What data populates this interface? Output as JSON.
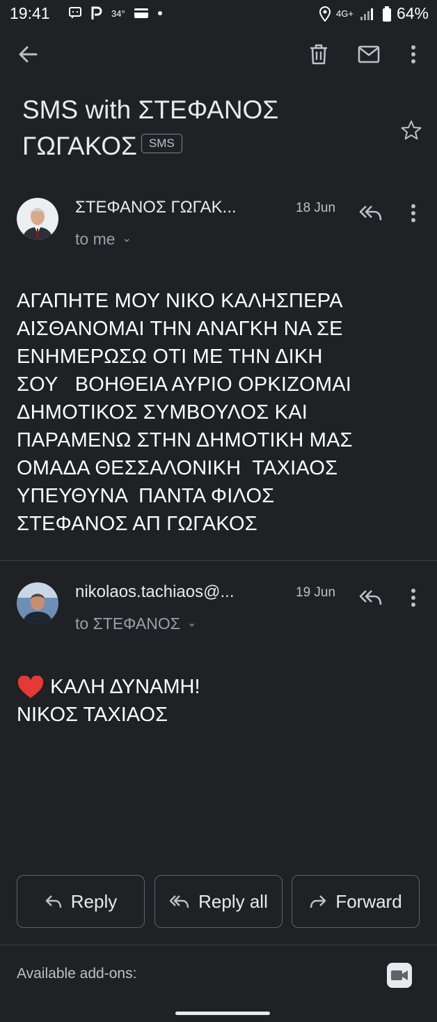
{
  "status_bar": {
    "time": "19:41",
    "temperature": "34°",
    "network": "4G+",
    "battery": "64%",
    "icons": [
      "message-icon",
      "parking-icon",
      "card-icon",
      "dot-icon",
      "location-icon",
      "signal-icon",
      "battery-icon"
    ]
  },
  "toolbar": {
    "icons": [
      "back-arrow-icon",
      "trash-icon",
      "mail-icon",
      "more-vert-icon"
    ]
  },
  "subject": {
    "title": "SMS with ΣΤΕΦΑΝΟΣ ΓΩΓΑΚΟΣ",
    "badge": "SMS"
  },
  "messages": [
    {
      "sender": "ΣΤΕΦΑΝΟΣ ΓΩΓΑΚ...",
      "date": "18 Jun",
      "to": "to me",
      "body": "ΑΓΑΠΗΤΕ ΜΟΥ ΝΙΚΟ ΚΑΛΗΣΠΕΡΑ\nΑΙΣΘΑΝΟΜΑΙ ΤΗΝ ΑΝΑΓΚΗ ΝΑ ΣΕ\nΕΝΗΜΕΡΩΣΩ ΟΤΙ ΜΕ ΤΗΝ ΔΙΚΗ\nΣΟΥ   ΒΟΗΘΕΙΑ ΑΥΡΙΟ ΟΡΚΙΖΟΜΑΙ\nΔΗΜΟΤΙΚΟΣ ΣΥΜΒΟΥΛΟΣ ΚΑΙ\nΠΑΡΑΜΕΝΩ ΣΤΗΝ ΔΗΜΟΤΙΚΗ ΜΑΣ\nΟΜΑΔΑ ΘΕΣΣΑΛΟΝΙΚΗ  ΤΑΧΙΑΟΣ\nΥΠΕΥΘΥΝΑ  ΠΑΝΤΑ ΦΙΛΟΣ\nΣΤΕΦΑΝΟΣ ΑΠ ΓΩΓΑΚΟΣ"
    },
    {
      "sender": "nikolaos.tachiaos@...",
      "date": "19 Jun",
      "to": "to ΣΤΕΦΑΝΟΣ",
      "body_line1": "ΚΑΛΗ ΔΥΝΑΜΗ!",
      "body_line2": "ΝΙΚΟΣ ΤΑΧΙΑΟΣ"
    }
  ],
  "actions": {
    "reply": "Reply",
    "reply_all": "Reply all",
    "forward": "Forward"
  },
  "addons": {
    "label": "Available add-ons:",
    "icon": "video-camera-icon"
  },
  "colors": {
    "background": "#202124",
    "text": "#e8eaed",
    "muted": "#9aa0a6",
    "heart": "#e53935"
  }
}
